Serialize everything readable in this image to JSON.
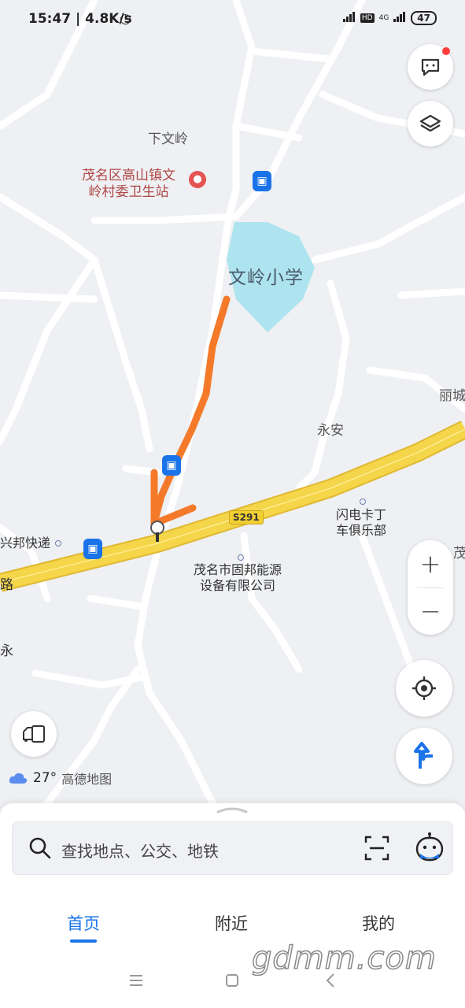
{
  "status_bar": {
    "time": "15:47 | 4.8K/s",
    "hd": "HD",
    "net": "4G",
    "battery": "47"
  },
  "map": {
    "place_labels": {
      "xiawenling": "下文岭",
      "yongan": "永安",
      "lichen": "丽城",
      "mao": "茂",
      "road_lu": "路",
      "yong": "永",
      "route": "S291"
    },
    "pois": {
      "clinic": [
        "茂名区高山镇文",
        "岭村委卫生站"
      ],
      "school": "文岭小学",
      "express": "兴邦快递",
      "club": [
        "闪电卡丁",
        "车俱乐部"
      ],
      "company": [
        "茂名市固邦能源",
        "设备有限公司"
      ]
    }
  },
  "weather": {
    "temp": "27°",
    "brand": "高德地图"
  },
  "search": {
    "placeholder": "查找地点、公交、地铁"
  },
  "tabs": [
    {
      "label": "首页"
    },
    {
      "label": "附近"
    },
    {
      "label": "我的"
    }
  ],
  "watermark": "gdmm.com",
  "colors": {
    "accent": "#1a73e8",
    "road": "#f5d64a",
    "water": "#aee4f0",
    "annotation": "#f47a2a"
  }
}
